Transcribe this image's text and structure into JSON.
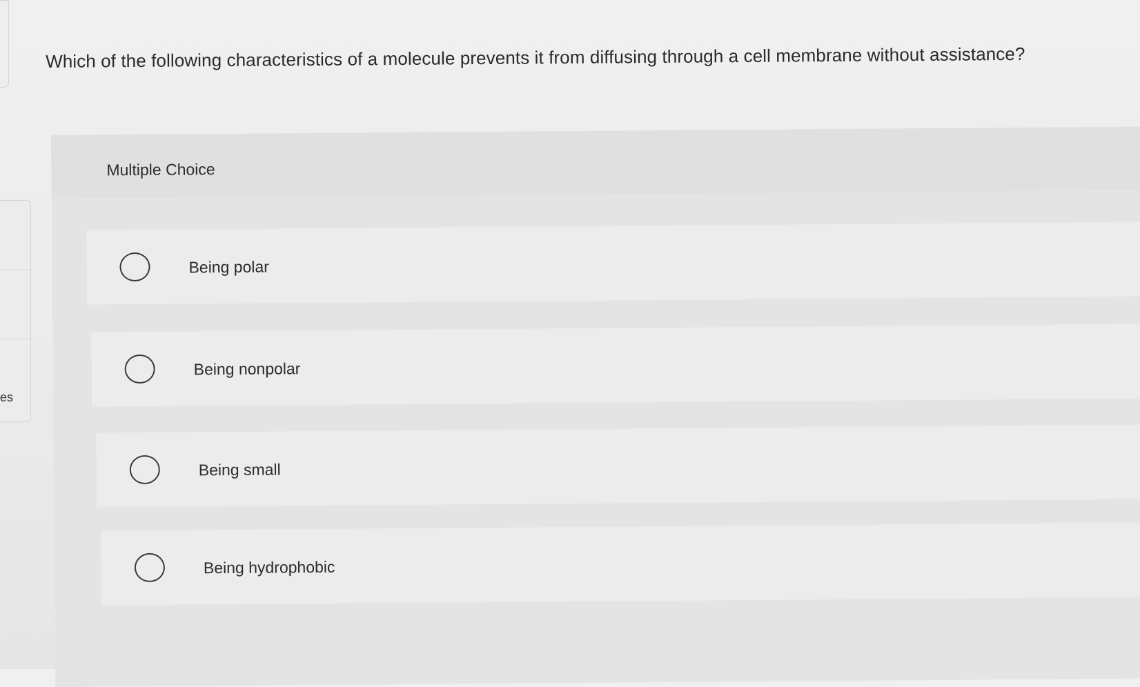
{
  "sidebar": {
    "label": "es"
  },
  "question": {
    "text": "Which of the following characteristics of a molecule prevents it from diffusing through a cell membrane without assistance?"
  },
  "multiple_choice": {
    "title": "Multiple Choice",
    "options": [
      {
        "label": "Being polar"
      },
      {
        "label": "Being nonpolar"
      },
      {
        "label": "Being small"
      },
      {
        "label": "Being hydrophobic"
      }
    ]
  }
}
